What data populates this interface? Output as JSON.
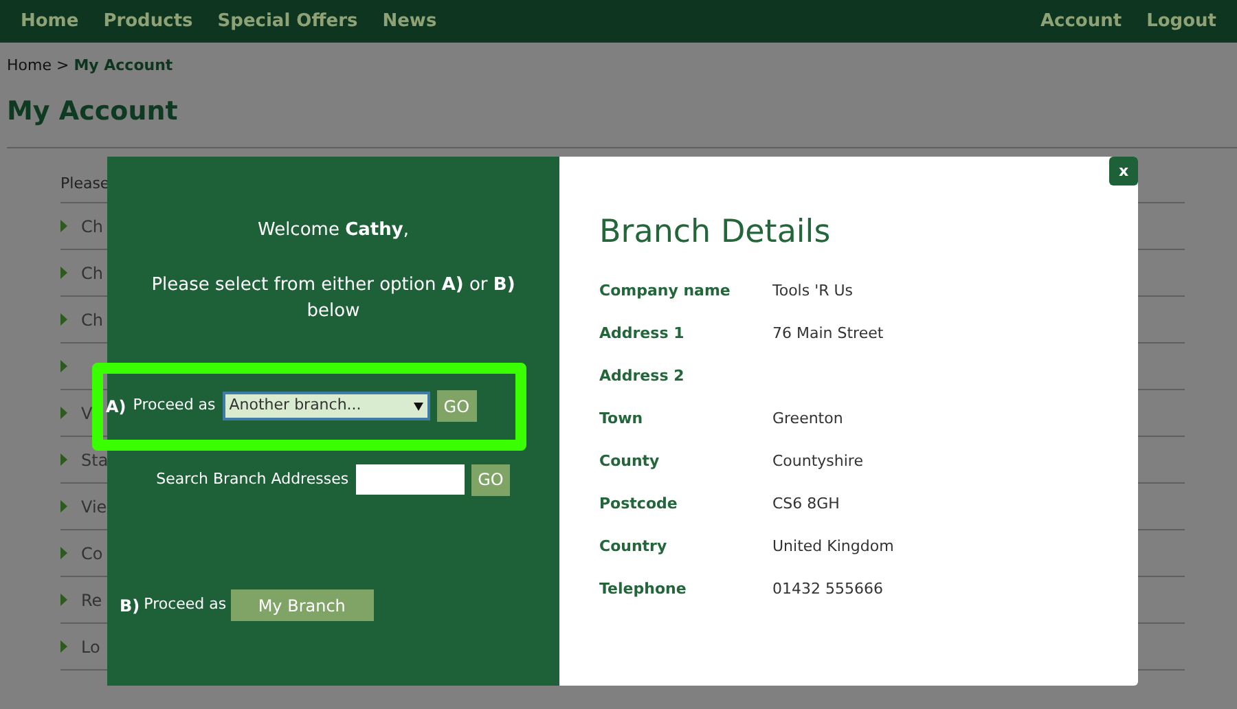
{
  "nav": {
    "left": [
      "Home",
      "Products",
      "Special Offers",
      "News"
    ],
    "right": [
      "Account",
      "Logout"
    ]
  },
  "breadcrumb": {
    "items": [
      "Home",
      "My Account"
    ],
    "separator": ">"
  },
  "page_title": "My Account",
  "account_menu": {
    "intro": "Please",
    "items": [
      {
        "label": "Ch",
        "arrow": true
      },
      {
        "label": "Ch",
        "arrow": true
      },
      {
        "label": "Ch",
        "arrow": true
      },
      {
        "arrow": true
      },
      {
        "label": "V",
        "arrow": true
      },
      {
        "label": "Sta",
        "arrow": true
      },
      {
        "label": "Vie",
        "arrow": true
      },
      {
        "label": "Co",
        "arrow": true
      },
      {
        "label": "Re",
        "arrow": true
      },
      {
        "label": "Lo",
        "arrow": true
      }
    ]
  },
  "modal": {
    "close": "x",
    "welcome": "Welcome **Cathy**,",
    "instruction": "Please select from either option **A)** or **B)** below",
    "option_a": {
      "marker": "A)",
      "label": "Proceed as",
      "select_value": "Another branch...",
      "button": "GO",
      "highlighted": true
    },
    "search": {
      "label": "Search Branch Addresses",
      "button": "GO"
    },
    "option_b": {
      "marker": "B)",
      "label": "Proceed as",
      "button": "My Branch"
    },
    "details": {
      "title": "Branch Details",
      "rows": [
        {
          "label": "Company name",
          "value": "Tools 'R Us"
        },
        {
          "label": "Address 1",
          "value": "76 Main Street"
        },
        {
          "label": "Address 2"
        },
        {
          "label": "Town",
          "value": "Greenton"
        },
        {
          "label": "County",
          "value": "Countyshire"
        },
        {
          "label": "Postcode",
          "value": "CS6 8GH"
        },
        {
          "label": "Country",
          "value": "United Kingdom"
        },
        {
          "label": "Telephone",
          "value": "01432 555666"
        }
      ]
    }
  }
}
